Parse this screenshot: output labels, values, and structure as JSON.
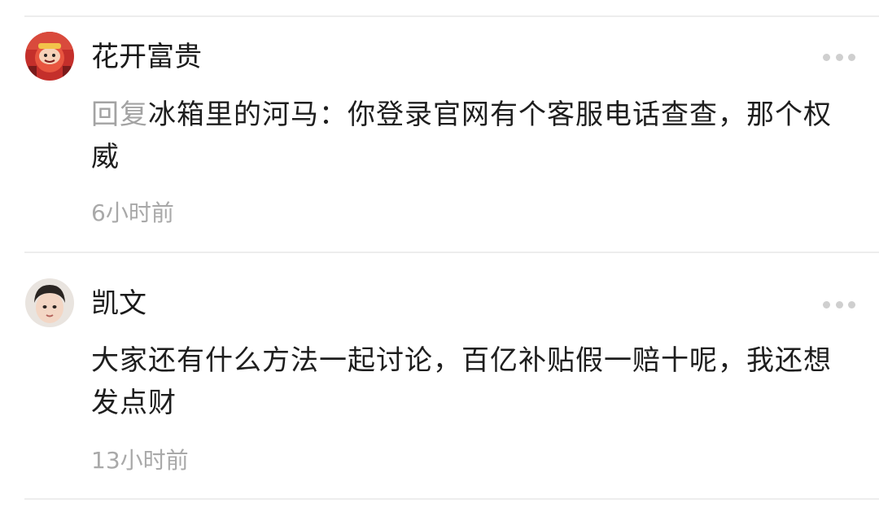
{
  "comments": [
    {
      "username": "花开富贵",
      "reply_prefix": "回复",
      "reply_to": "冰箱里的河马",
      "separator": "：",
      "text": "你登录官网有个客服电话查查，那个权威",
      "time": "6小时前",
      "avatar_icon": "red-cartoon-avatar",
      "more_icon": "more-dots-icon"
    },
    {
      "username": "凯文",
      "text": "大家还有什么方法一起讨论，百亿补贴假一赔十呢，我还想发点财",
      "time": "13小时前",
      "avatar_icon": "child-photo-avatar",
      "more_icon": "more-dots-icon"
    }
  ],
  "colors": {
    "username": "#1a1a1a",
    "body": "#1e1e1e",
    "muted": "#a3a3a3",
    "divider": "#ededed",
    "dots": "#cfcfcf"
  }
}
